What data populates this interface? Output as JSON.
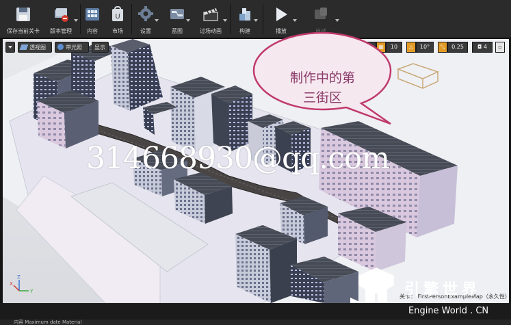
{
  "toolbar": {
    "save_current": "保存当前关卡",
    "source_control": "版本管理",
    "content": "内容",
    "marketplace": "市场",
    "settings": "设置",
    "blueprints": "蓝图",
    "cinematics": "过场动画",
    "build": "构建",
    "play": "播放",
    "launch": "启动"
  },
  "viewport": {
    "perspective": "透视图",
    "lit": "带光照",
    "show": "显示",
    "grid_snap": "10",
    "rotation_snap": "10°",
    "scale_snap": "0.25",
    "camera_speed": "4"
  },
  "callout": {
    "line1": "制作中的第",
    "line2": "三街区"
  },
  "watermark": "314668930@qq.com",
  "status": "关卡：  FirstPersonExampleMap（永久性）",
  "logo": {
    "title": "引擎世界",
    "subtitle": "Engine World . CN"
  },
  "bottom_bar": {
    "text": "内容   Maximum    date   Material"
  },
  "colors": {
    "accent_orange": "#e29a24",
    "bubble_fill": "#f6e8ef",
    "bubble_border": "#c03a6b",
    "text_pink": "#8a3b6a"
  }
}
